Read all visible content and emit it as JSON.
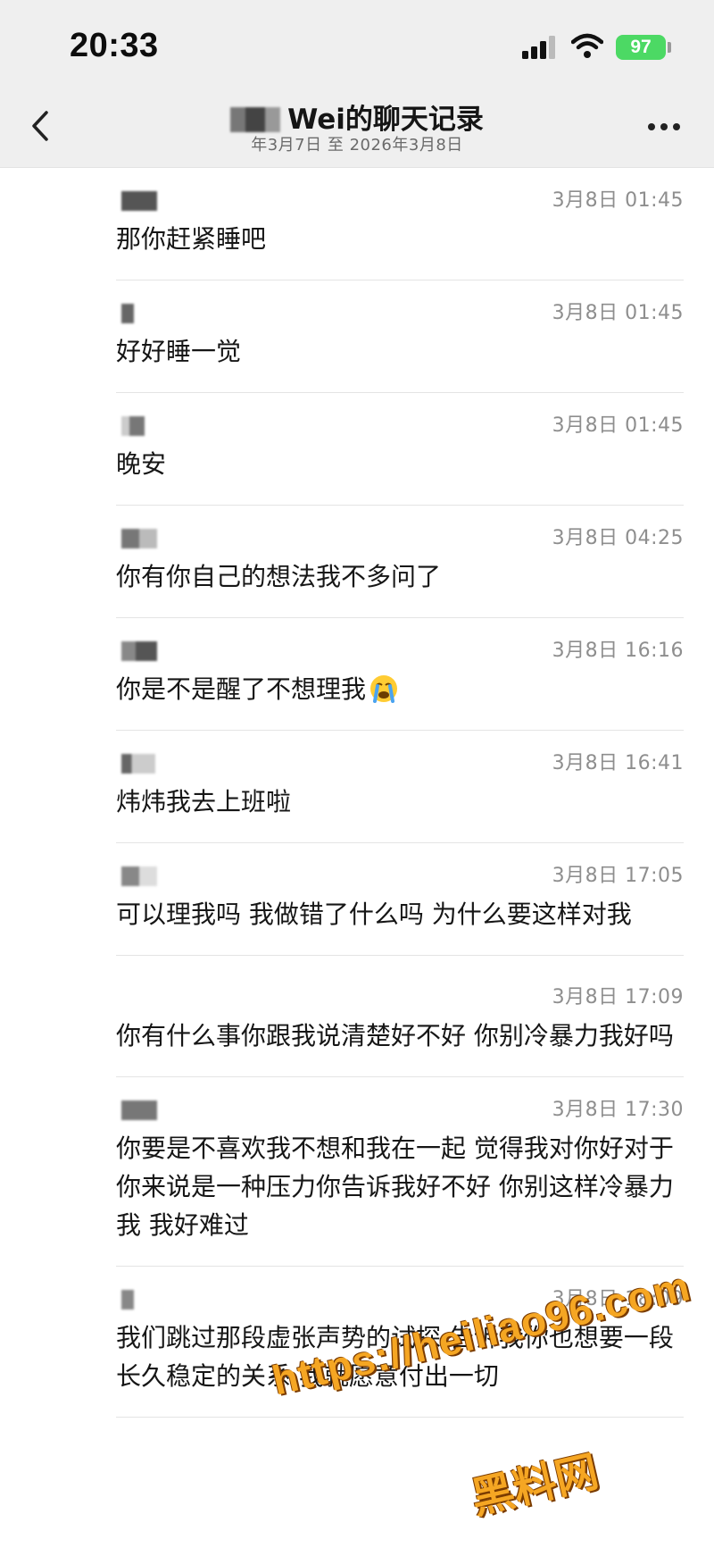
{
  "status_bar": {
    "time": "20:33",
    "battery": "97",
    "icons": [
      "signal-icon",
      "wifi-icon",
      "battery-icon"
    ]
  },
  "header": {
    "title": "Wei的聊天记录",
    "subtitle": "年3月7日 至 2026年3月8日",
    "left_icon": "back-chevron-icon",
    "right_icon": "more-icon"
  },
  "messages": [
    {
      "time": "3月8日 01:45",
      "text": "那你赶紧睡吧"
    },
    {
      "time": "3月8日 01:45",
      "text": "好好睡一觉"
    },
    {
      "time": "3月8日 01:45",
      "text": "晚安"
    },
    {
      "time": "3月8日 04:25",
      "text": "你有你自己的想法我不多问了"
    },
    {
      "time": "3月8日 16:16",
      "text": "你是不是醒了不想理我",
      "emoji": "crying-face-emoji"
    },
    {
      "time": "3月8日 16:41",
      "text": "炜炜我去上班啦"
    },
    {
      "time": "3月8日 17:05",
      "text": "可以理我吗 我做错了什么吗 为什么要这样对我"
    },
    {
      "time": "3月8日 17:09",
      "text": "你有什么事你跟我说清楚好不好 你别冷暴力我好吗"
    },
    {
      "time": "3月8日 17:30",
      "text": "你要是不喜欢我不想和我在一起 觉得我对你好对于你来说是一种压力你告诉我好不好 你别这样冷暴力我 我好难过"
    },
    {
      "time": "3月8日 18:09",
      "text": "我们跳过那段虚张声势的试探 告诉我你也想要一段长久稳定的关系 我就愿意付出一切"
    }
  ],
  "watermark": {
    "url": "https://heiliao96.com",
    "label": "黑料网",
    "color": "#f5a623"
  },
  "colors": {
    "header_bg": "#efefef",
    "timestamp": "#8e8e8e",
    "battery": "#4cd964"
  }
}
